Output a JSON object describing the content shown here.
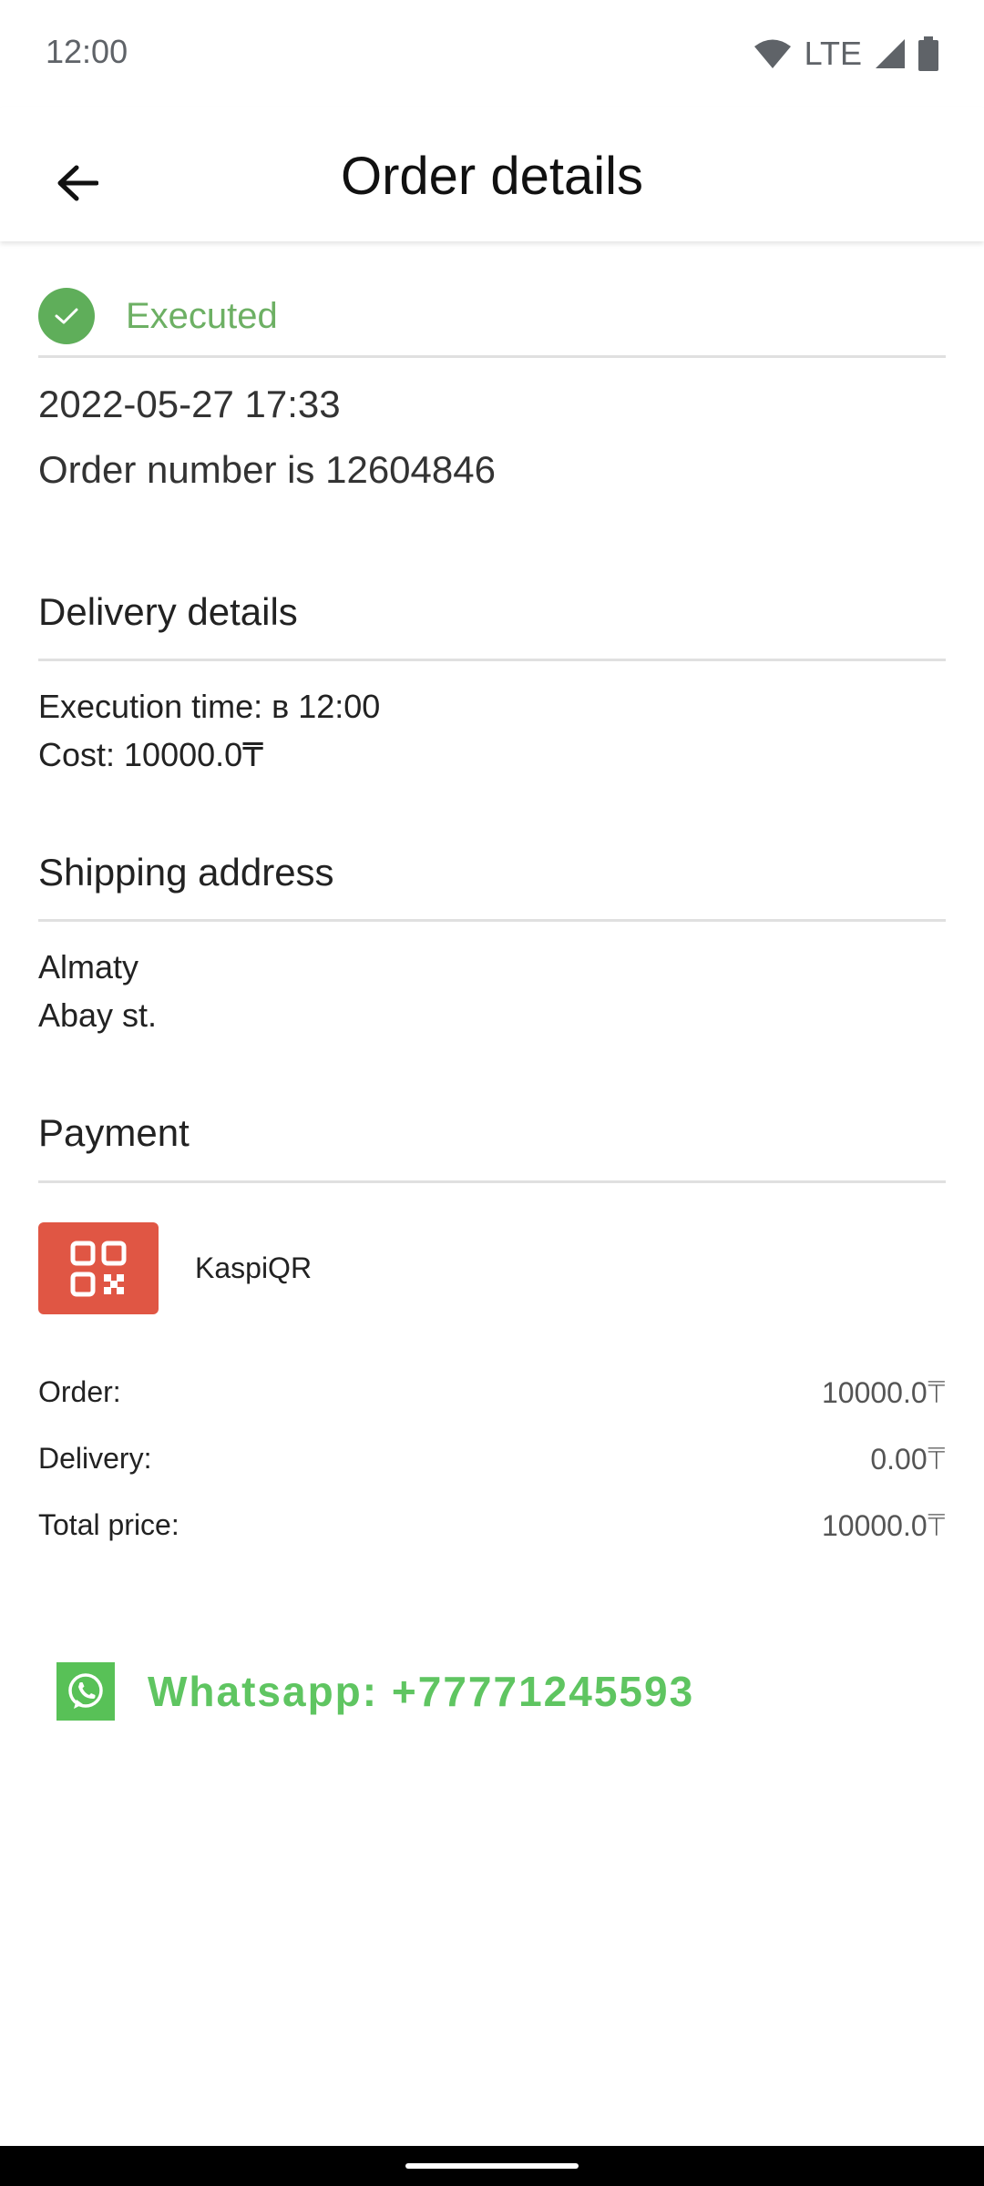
{
  "status_bar": {
    "time": "12:00",
    "network": "LTE"
  },
  "app_bar": {
    "title": "Order details",
    "back_icon": "arrow-left-icon"
  },
  "order": {
    "status": "Executed",
    "status_color": "#6db064",
    "datetime": "2022-05-27 17:33",
    "number_text": "Order number is 12604846"
  },
  "delivery": {
    "title": "Delivery details",
    "execution_time": "Execution time: в 12:00",
    "cost": "Cost: 10000.0₸"
  },
  "shipping": {
    "title": "Shipping address",
    "city": "Almaty",
    "street": "Abay st."
  },
  "payment": {
    "title": "Payment",
    "method": "KaspiQR",
    "icon": "qr-code-icon",
    "icon_color": "#e05644"
  },
  "summary": [
    {
      "label": "Order:",
      "value": "10000.0₸"
    },
    {
      "label": "Delivery:",
      "value": "0.00₸"
    },
    {
      "label": "Total price:",
      "value": "10000.0₸"
    }
  ],
  "contact": {
    "whatsapp_text": "Whatsapp: +77771245593",
    "icon": "whatsapp-icon",
    "color": "#5fc561"
  }
}
